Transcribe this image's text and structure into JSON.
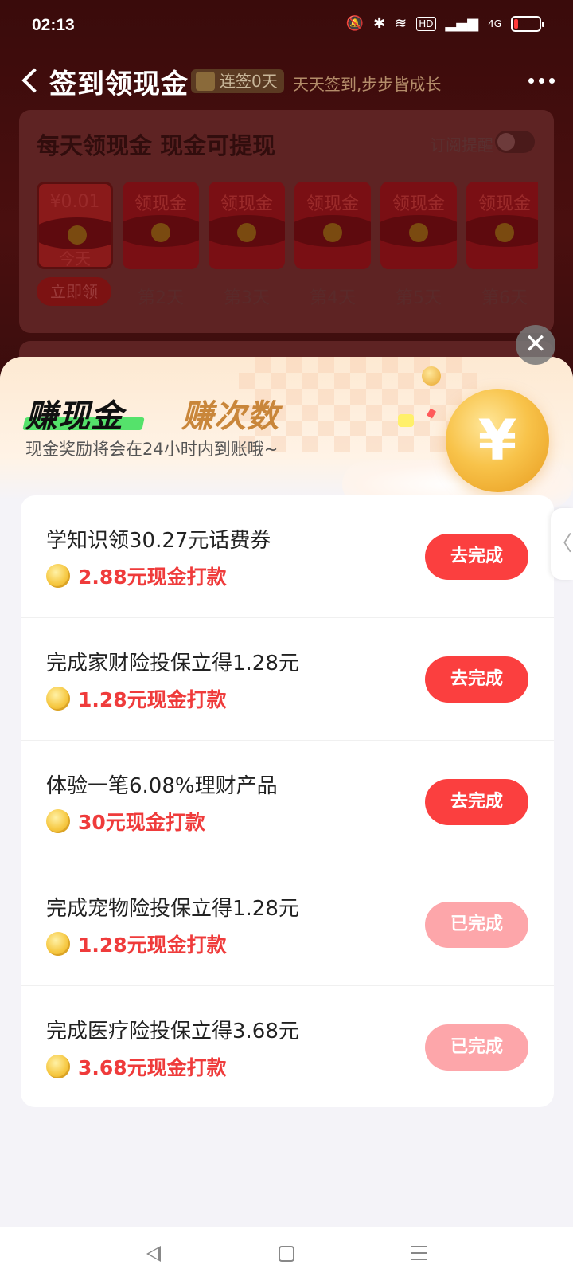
{
  "status_bar": {
    "time": "02:13",
    "icons": [
      "mute-icon",
      "bluetooth-icon",
      "wifi-icon",
      "hd-icon",
      "signal-icon",
      "4g-signal-icon",
      "battery-icon"
    ],
    "hd_label": "HD",
    "net_label": "4G"
  },
  "nav": {
    "title": "签到领现金",
    "streak_badge": "连签0天",
    "slogan": "天天签到,步步皆成长"
  },
  "checkin": {
    "title": "每天领现金 现金可提现",
    "subscribe_label": "订阅提醒",
    "subscribe_on": false,
    "days": [
      {
        "amount": "¥0.01",
        "sub": "今天",
        "label": "立即领"
      },
      {
        "amount": "领现金",
        "sub": "",
        "label": "第2天"
      },
      {
        "amount": "领现金",
        "sub": "",
        "label": "第3天"
      },
      {
        "amount": "领现金",
        "sub": "",
        "label": "第4天"
      },
      {
        "amount": "领现金",
        "sub": "",
        "label": "第5天"
      },
      {
        "amount": "领现金",
        "sub": "",
        "label": "第6天"
      }
    ]
  },
  "sheet": {
    "tab_active": "赚现金",
    "tab_inactive": "赚次数",
    "subtitle": "现金奖励将会在24小时内到账哦~",
    "coin_symbol": "¥",
    "close_symbol": "✕",
    "side_handle_symbol": "〈"
  },
  "tasks": [
    {
      "title": "学知识领30.27元话费券",
      "reward": "2.88元现金打款",
      "button": "去完成",
      "done": false
    },
    {
      "title": "完成家财险投保立得1.28元",
      "reward": "1.28元现金打款",
      "button": "去完成",
      "done": false
    },
    {
      "title": "体验一笔6.08%理财产品",
      "reward": "30元现金打款",
      "button": "去完成",
      "done": false
    },
    {
      "title": "完成宠物险投保立得1.28元",
      "reward": "1.28元现金打款",
      "button": "已完成",
      "done": true
    },
    {
      "title": "完成医疗险投保立得3.68元",
      "reward": "3.68元现金打款",
      "button": "已完成",
      "done": true
    }
  ],
  "colors": {
    "accent_red": "#fb3f3f",
    "done_pink": "#fda6aa",
    "reward_red": "#ef3b3b",
    "tab_highlight": "#55e26b",
    "tab_inactive_gold": "#c9863a"
  }
}
